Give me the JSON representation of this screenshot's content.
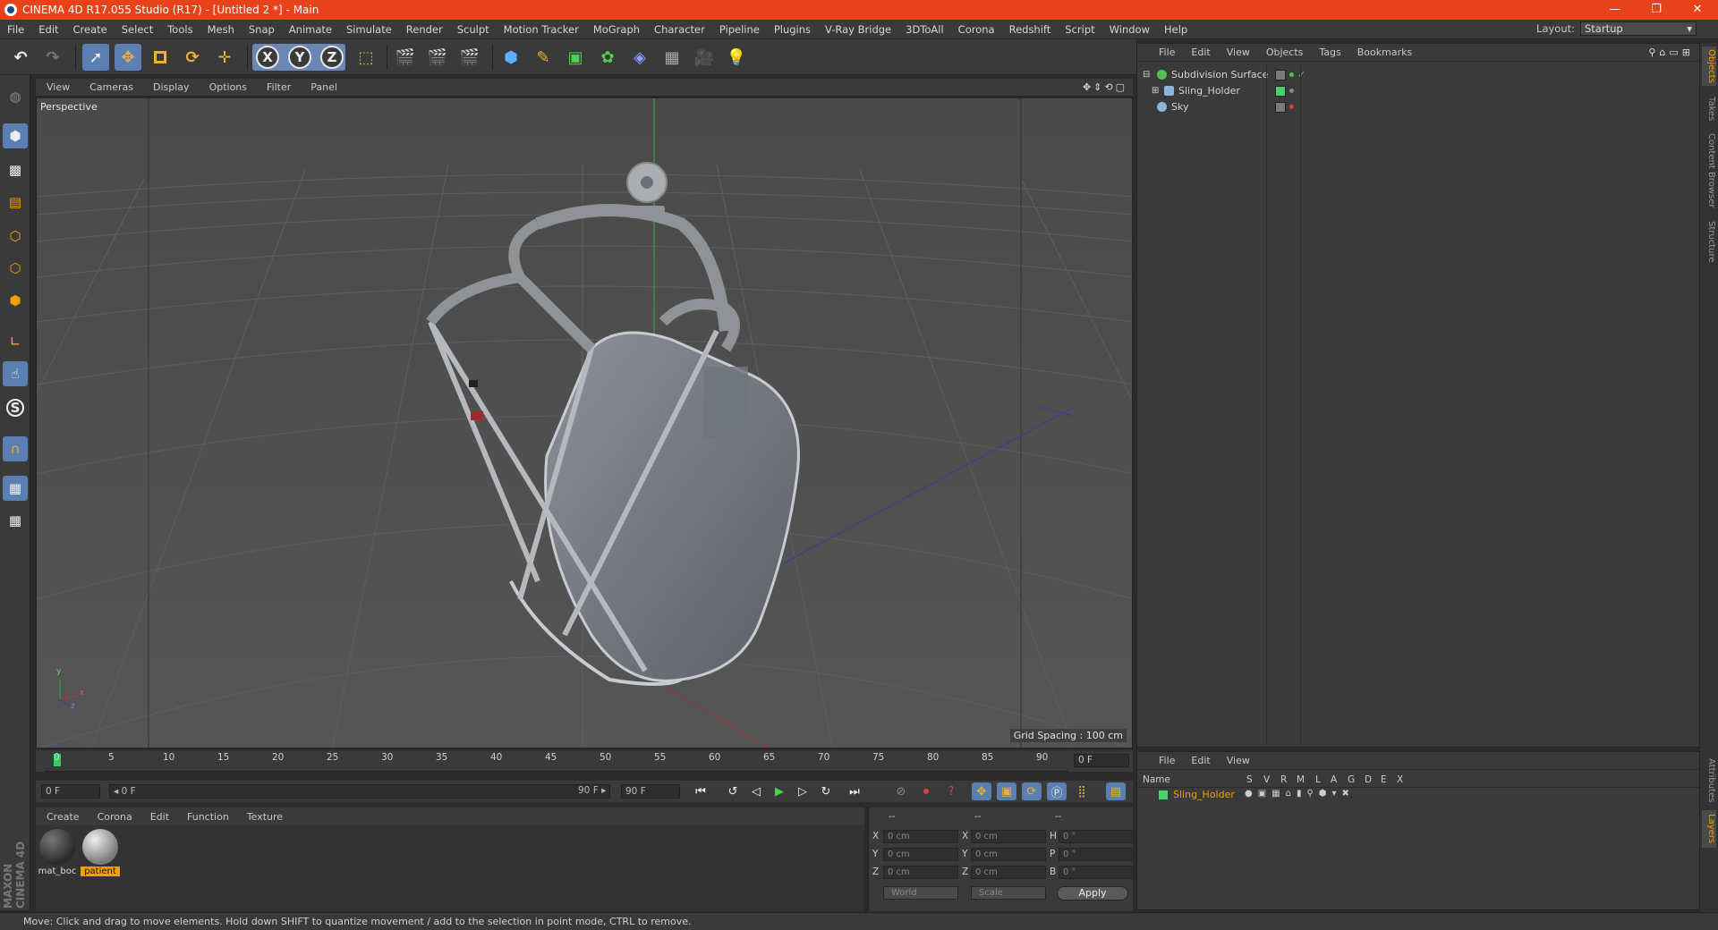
{
  "window": {
    "title": "CINEMA 4D R17.055 Studio (R17) - [Untitled 2 *] - Main",
    "controls": [
      "—",
      "❐",
      "✕"
    ]
  },
  "menu": [
    "File",
    "Edit",
    "Create",
    "Select",
    "Tools",
    "Mesh",
    "Snap",
    "Animate",
    "Simulate",
    "Render",
    "Sculpt",
    "Motion Tracker",
    "MoGraph",
    "Character",
    "Pipeline",
    "Plugins",
    "V-Ray Bridge",
    "3DToAll",
    "Corona",
    "Redshift",
    "Script",
    "Window",
    "Help"
  ],
  "layout": {
    "label": "Layout:",
    "value": "Startup"
  },
  "toolbar": {
    "axis_x": "X",
    "axis_y": "Y",
    "axis_z": "Z"
  },
  "left_tools": {
    "snap_label": "S"
  },
  "viewport": {
    "menu": [
      "View",
      "Cameras",
      "Display",
      "Options",
      "Filter",
      "Panel"
    ],
    "label": "Perspective",
    "grid_spacing": "Grid Spacing : 100 cm",
    "axis_y": "y",
    "axis_x": "x",
    "axis_z": "z"
  },
  "timeline": {
    "ticks": [
      "0",
      "5",
      "10",
      "15",
      "20",
      "25",
      "30",
      "35",
      "40",
      "45",
      "50",
      "55",
      "60",
      "65",
      "70",
      "75",
      "80",
      "85",
      "90"
    ],
    "current_frame": "0 F",
    "start": "0 F",
    "range_start": "◂ 0 F",
    "range_end": "90 F ▸",
    "end": "90 F"
  },
  "materials": {
    "menu": [
      "Create",
      "Corona",
      "Edit",
      "Function",
      "Texture"
    ],
    "items": [
      {
        "name": "mat_boc",
        "selected": false,
        "color": "#3c3c3c"
      },
      {
        "name": "patient",
        "selected": true,
        "color": "#8c8c8c"
      }
    ],
    "brand": "MAXON CINEMA 4D"
  },
  "coordinates": {
    "headers": [
      "--",
      "--",
      "--"
    ],
    "rows": [
      {
        "a": "X",
        "av": "0 cm",
        "b": "X",
        "bv": "0 cm",
        "c": "H",
        "cv": "0 °"
      },
      {
        "a": "Y",
        "av": "0 cm",
        "b": "Y",
        "bv": "0 cm",
        "c": "P",
        "cv": "0 °"
      },
      {
        "a": "Z",
        "av": "0 cm",
        "b": "Z",
        "bv": "0 cm",
        "c": "B",
        "cv": "0 °"
      }
    ],
    "mode": "World",
    "type": "Scale",
    "apply": "Apply"
  },
  "status": "Move: Click and drag to move elements. Hold down SHIFT to quantize movement / add to the selection in point mode, CTRL to remove.",
  "objects": {
    "menu": [
      "File",
      "Edit",
      "View",
      "Objects",
      "Tags",
      "Bookmarks"
    ],
    "items": [
      {
        "name": "Subdivision Surface",
        "icon_color": "#4fc04f"
      },
      {
        "name": "Sling_Holder",
        "icon_color": "#8ab4d8"
      },
      {
        "name": "Sky",
        "icon_color": "#8ab4d8"
      }
    ]
  },
  "side_tabs": [
    "Objects",
    "Takes",
    "Content Browser",
    "Structure",
    "Attributes",
    "Layers"
  ],
  "layers": {
    "menu": [
      "File",
      "Edit",
      "View"
    ],
    "columns": [
      "Name",
      "S",
      "V",
      "R",
      "M",
      "L",
      "A",
      "G",
      "D",
      "E",
      "X"
    ],
    "rows": [
      {
        "name": "Sling_Holder",
        "color": "#46d26e"
      }
    ]
  }
}
